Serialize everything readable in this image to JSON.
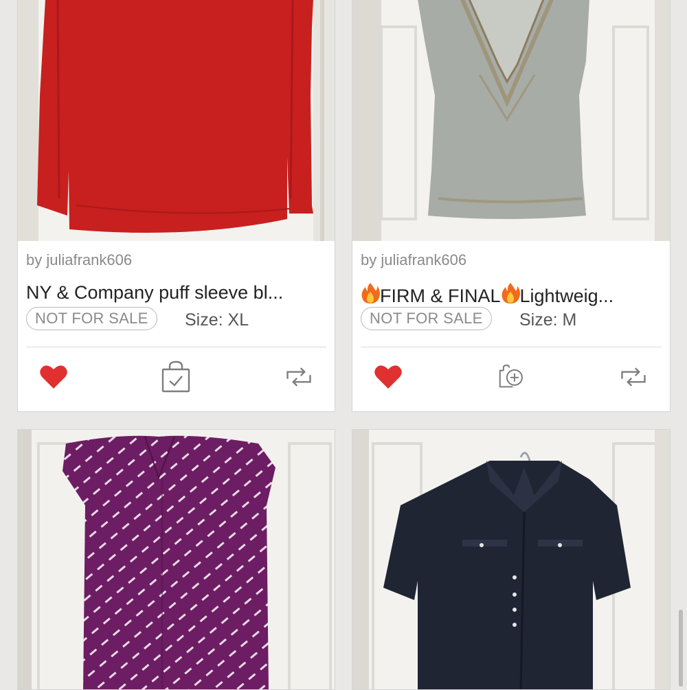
{
  "colors": {
    "like": "#e0302f",
    "icon_gray": "#7d7d7d",
    "text_gray": "#8a8a8a"
  },
  "listings": [
    {
      "seller": "by juliafrank606",
      "title": "NY & Company puff sleeve bl...",
      "badge": "NOT FOR SALE",
      "size": "Size: XL",
      "actions": {
        "like": "heart-icon",
        "middle": "shopping-bag-check-icon",
        "share": "repost-icon"
      }
    },
    {
      "seller": "by juliafrank606",
      "title_parts": [
        "FIRM & FINAL",
        "Lightweig..."
      ],
      "title_emoji": "fire-icon",
      "badge": "NOT FOR SALE",
      "size": "Size: M",
      "actions": {
        "like": "heart-icon",
        "middle": "add-to-bundle-icon",
        "share": "repost-icon"
      }
    },
    {
      "photo": "purple-patterned-top-photo"
    },
    {
      "photo": "navy-button-shirt-photo"
    }
  ]
}
